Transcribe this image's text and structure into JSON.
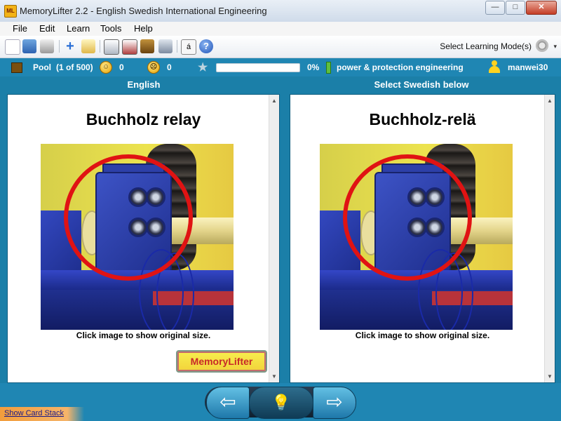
{
  "window": {
    "app_icon_text": "ML",
    "title": "MemoryLifter 2.2 - English Swedish International Engineering",
    "minimize": "—",
    "maximize": "□",
    "close": "✕"
  },
  "menu": [
    "File",
    "Edit",
    "Learn",
    "Tools",
    "Help"
  ],
  "toolbar": {
    "icons": [
      "new-document-icon",
      "open-folder-icon",
      "print-icon",
      "add-card-icon",
      "edit-card-icon",
      "presentation-icon",
      "slideshow-icon",
      "card-stack-icon",
      "tools-icon",
      "special-character-icon",
      "help-icon"
    ],
    "special_char_glyph": "á",
    "help_glyph": "?",
    "mode_label": "Select Learning Mode(s)",
    "mode_arrow": "▾"
  },
  "status": {
    "pool_label": "Pool",
    "pool_count": "(1 of 500)",
    "correct_count": "0",
    "wrong_count": "0",
    "progress_fraction": 0.0,
    "progress_percent": "0%",
    "dictionary": "power & protection engineering",
    "user": "manwei30"
  },
  "columns": {
    "left": "English",
    "right": "Select Swedish below"
  },
  "card": {
    "question_word": "Buchholz relay",
    "answer_word": "Buchholz-relä",
    "caption_left": "Click image to show original size.",
    "caption_right": "Click image to show original size."
  },
  "logo": {
    "part1": "Memory",
    "part2": "Lifter"
  },
  "nav": {
    "prev": "⇦",
    "hint": "💡",
    "next": "⇨"
  },
  "footer": {
    "show_card_stack": "Show Card Stack"
  },
  "scroll": {
    "up": "▲",
    "down": "▼"
  }
}
